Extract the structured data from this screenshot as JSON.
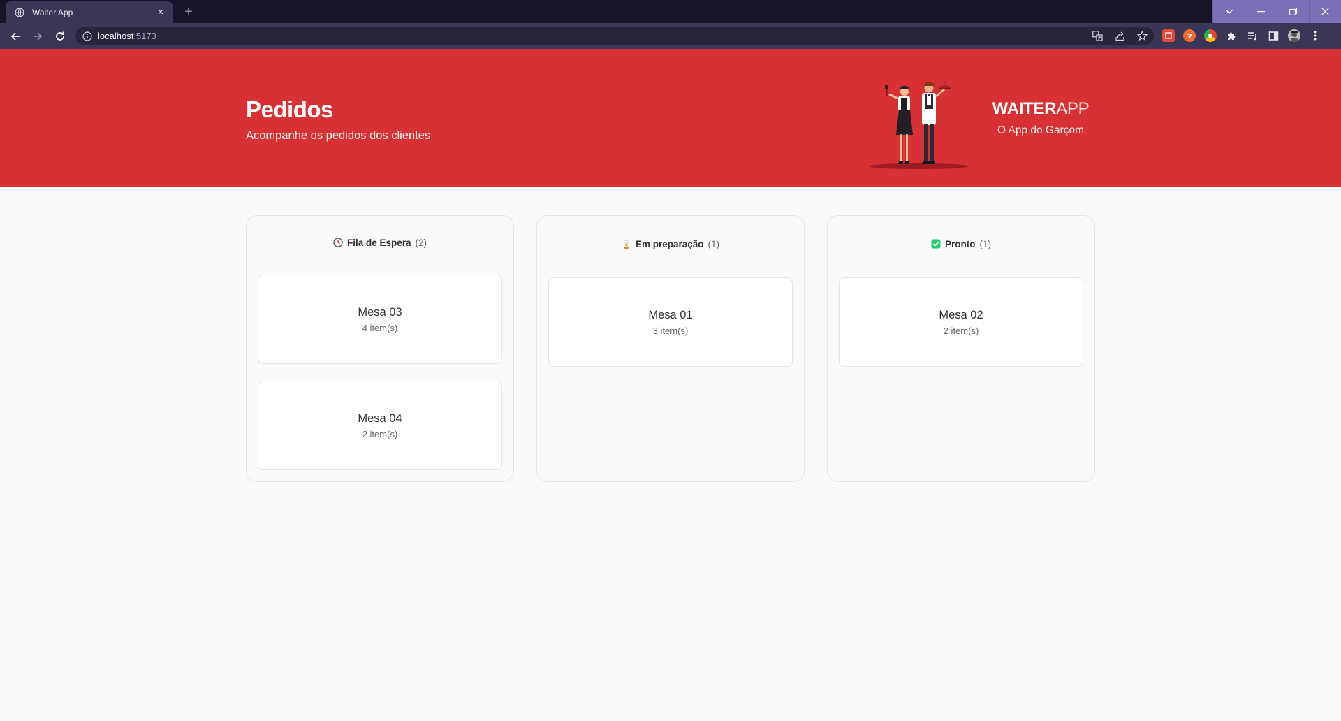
{
  "browser": {
    "tab_title": "Waiter App",
    "tab_close": "×",
    "new_tab": "+",
    "url_host": "localhost",
    "url_port": ":5173"
  },
  "header": {
    "title": "Pedidos",
    "subtitle": "Acompanhe os pedidos dos clientes",
    "brand_bold": "WAITER",
    "brand_light": "APP",
    "slogan": "O App do Garçom"
  },
  "columns": [
    {
      "icon": "clock-icon",
      "title": "Fila de Espera",
      "count": "(2)",
      "orders": [
        {
          "table": "Mesa 03",
          "items": "4 item(s)"
        },
        {
          "table": "Mesa 04",
          "items": "2 item(s)"
        }
      ]
    },
    {
      "icon": "cook-icon",
      "title": "Em preparação",
      "count": "(1)",
      "orders": [
        {
          "table": "Mesa 01",
          "items": "3 item(s)"
        }
      ]
    },
    {
      "icon": "check-icon",
      "title": "Pronto",
      "count": "(1)",
      "orders": [
        {
          "table": "Mesa 02",
          "items": "2 item(s)"
        }
      ]
    }
  ],
  "colors": {
    "header_red": "#d73035",
    "ready_green": "#2ecc71",
    "window_accent": "#7b6fb8"
  }
}
